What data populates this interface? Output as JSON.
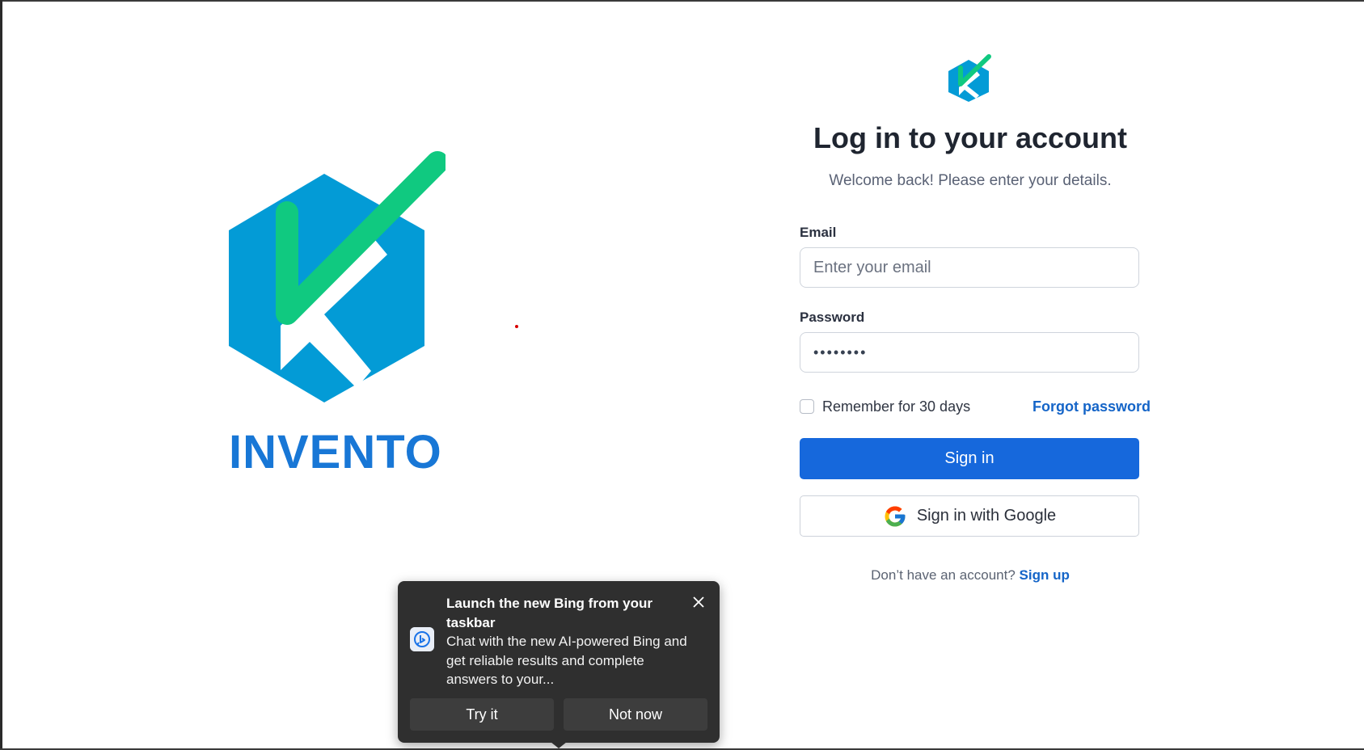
{
  "brand": {
    "name": "INVENTO",
    "colors": {
      "hexagon": "#039bd6",
      "check": "#10c980",
      "name": "#1877d6"
    }
  },
  "login": {
    "title": "Log in to your account",
    "subtitle": "Welcome back! Please enter your details.",
    "email": {
      "label": "Email",
      "placeholder": "Enter your email",
      "value": ""
    },
    "password": {
      "label": "Password",
      "value_masked": "••••••••"
    },
    "remember": {
      "label": "Remember for 30 days",
      "checked": false
    },
    "forgot_label": "Forgot password",
    "signin_label": "Sign in",
    "google_label": "Sign in with Google",
    "signup_prompt": "Don’t have an account?",
    "signup_label": "Sign up",
    "accent": "#1668dc"
  },
  "toast": {
    "icon": "bing-icon",
    "title": "Launch the new Bing from your taskbar",
    "body": "Chat with the new AI-powered Bing and get reliable results and complete answers to your...",
    "try_label": "Try it",
    "not_now_label": "Not now"
  }
}
